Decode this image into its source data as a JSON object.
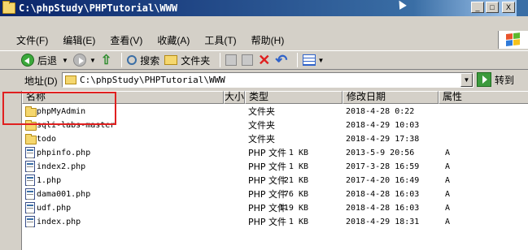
{
  "window": {
    "title": "C:\\phpStudy\\PHPTutorial\\WWW",
    "buttons": [
      "_",
      "□",
      "X"
    ]
  },
  "menu": [
    "文件(F)",
    "编辑(E)",
    "查看(V)",
    "收藏(A)",
    "工具(T)",
    "帮助(H)"
  ],
  "toolbar": {
    "back_label": "后退",
    "search_label": "搜索",
    "folders_label": "文件夹"
  },
  "address": {
    "label": "地址(D)",
    "value": "C:\\phpStudy\\PHPTutorial\\WWW",
    "go_label": "转到"
  },
  "columns": [
    "名称",
    "大小",
    "类型",
    "修改日期",
    "属性"
  ],
  "files": [
    {
      "name": "phpMyAdmin",
      "size": "",
      "type": "文件夹",
      "modified": "2018-4-28 0:22",
      "attr": "",
      "icon": "folder-icon"
    },
    {
      "name": "sqli-labs-master",
      "size": "",
      "type": "文件夹",
      "modified": "2018-4-29 10:03",
      "attr": "",
      "icon": "folder-icon"
    },
    {
      "name": "todo",
      "size": "",
      "type": "文件夹",
      "modified": "2018-4-29 17:38",
      "attr": "",
      "icon": "folder-icon"
    },
    {
      "name": "phpinfo.php",
      "size": "1 KB",
      "type": "PHP 文件",
      "modified": "2013-5-9 20:56",
      "attr": "A",
      "icon": "php-file-icon"
    },
    {
      "name": "index2.php",
      "size": "1 KB",
      "type": "PHP 文件",
      "modified": "2017-3-28 16:59",
      "attr": "A",
      "icon": "php-file-icon"
    },
    {
      "name": "1.php",
      "size": "21 KB",
      "type": "PHP 文件",
      "modified": "2017-4-20 16:49",
      "attr": "A",
      "icon": "php-file-icon"
    },
    {
      "name": "dama001.php",
      "size": "76 KB",
      "type": "PHP 文件",
      "modified": "2018-4-28 16:03",
      "attr": "A",
      "icon": "php-file-icon"
    },
    {
      "name": "udf.php",
      "size": "119 KB",
      "type": "PHP 文件",
      "modified": "2018-4-28 16:03",
      "attr": "A",
      "icon": "php-file-icon"
    },
    {
      "name": "index.php",
      "size": "1 KB",
      "type": "PHP 文件",
      "modified": "2018-4-29 18:31",
      "attr": "A",
      "icon": "php-file-icon"
    }
  ],
  "colors": {
    "title_start": "#0a246a",
    "title_end": "#a6caf0",
    "highlight_box": "#e02020"
  }
}
